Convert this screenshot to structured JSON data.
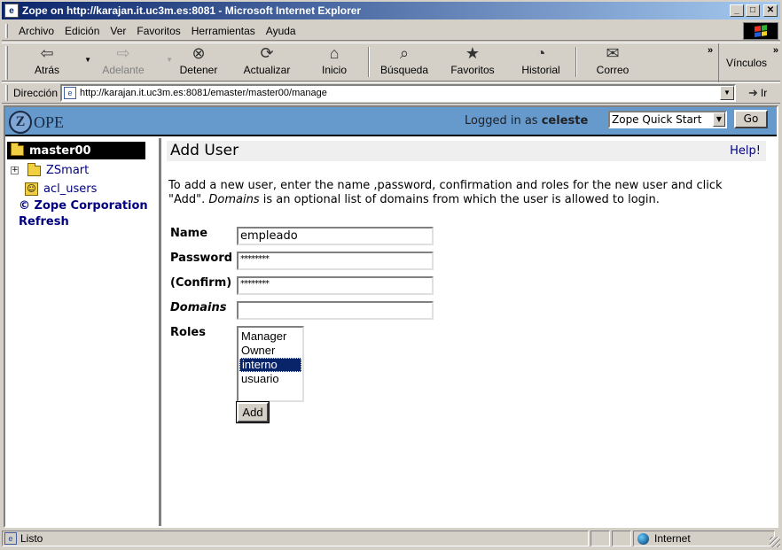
{
  "window": {
    "title": "Zope on http://karajan.it.uc3m.es:8081 - Microsoft Internet Explorer",
    "min_glyph": "_",
    "max_glyph": "□",
    "close_glyph": "✕"
  },
  "menu": [
    "Archivo",
    "Edición",
    "Ver",
    "Favoritos",
    "Herramientas",
    "Ayuda"
  ],
  "toolbar": {
    "back": "Atrás",
    "forward": "Adelante",
    "stop": "Detener",
    "refresh": "Actualizar",
    "home": "Inicio",
    "search": "Búsqueda",
    "favorites": "Favoritos",
    "history": "Historial",
    "mail": "Correo",
    "links": "Vínculos",
    "chevron": "»"
  },
  "address": {
    "label": "Dirección",
    "url": "http://karajan.it.uc3m.es:8081/emaster/master00/manage",
    "go": "Ir"
  },
  "zope": {
    "logo_letter": "Z",
    "logo_word": "OPE",
    "logged_prefix": "Logged in as",
    "user": "celeste",
    "quickstart": "Zope Quick Start",
    "go": "Go"
  },
  "tree": {
    "root": "master00",
    "items": [
      "ZSmart",
      "acl_users"
    ],
    "links": [
      "© Zope Corporation",
      "Refresh"
    ]
  },
  "form": {
    "title": "Add User",
    "help": "Help!",
    "desc_part1": "To add a new user, enter the name ,password, confirmation and roles for the new user and click \"Add\". ",
    "desc_em": "Domains",
    "desc_part2": " is an optional list of domains from which the user is allowed to login.",
    "labels": {
      "name": "Name",
      "password": "Password",
      "confirm": "(Confirm)",
      "domains": "Domains",
      "roles": "Roles"
    },
    "values": {
      "name": "empleado",
      "password": "********",
      "confirm": "********",
      "domains": ""
    },
    "roles": [
      "Manager",
      "Owner",
      "interno",
      "usuario"
    ],
    "selected_role": "interno",
    "add": "Add"
  },
  "status": {
    "text": "Listo",
    "zone": "Internet"
  },
  "colors": {
    "zope_header": "#6699cc",
    "selection": "#0a246a"
  }
}
